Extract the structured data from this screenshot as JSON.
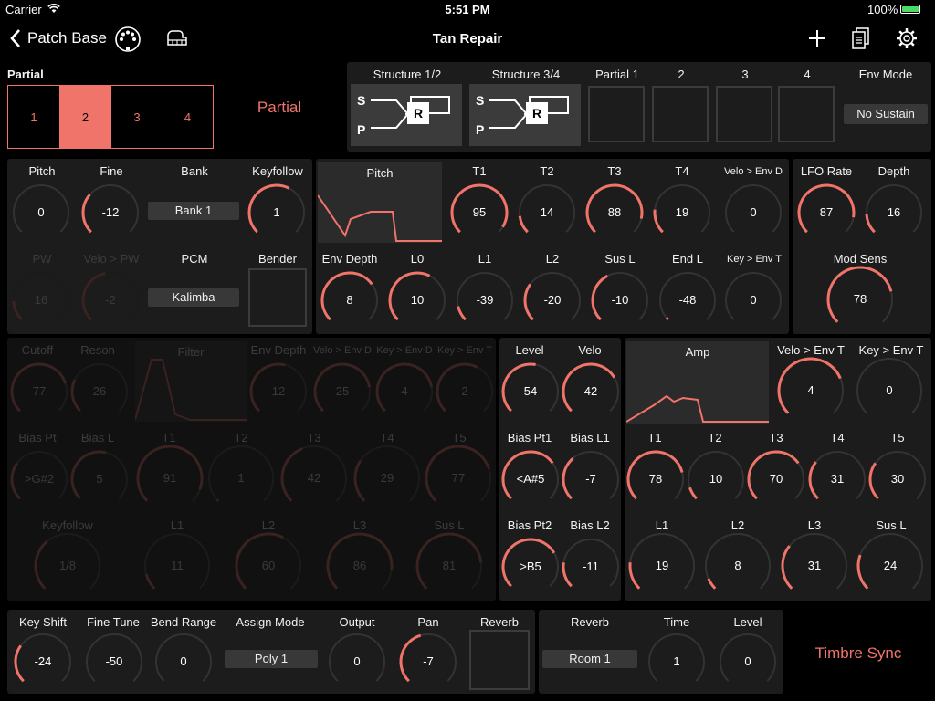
{
  "status": {
    "carrier": "Carrier",
    "time": "5:51 PM",
    "battery": "100%"
  },
  "nav": {
    "back": "Patch Base",
    "title": "Tan Repair",
    "icons": [
      "chevron-left-icon",
      "midi-icon",
      "piano-icon",
      "plus-icon",
      "documents-icon",
      "gear-icon"
    ]
  },
  "accent": "#f0746a",
  "partial_selector": {
    "label": "Partial",
    "items": [
      "1",
      "2",
      "3",
      "4"
    ],
    "selected": "2",
    "side_label": "Partial"
  },
  "structure": {
    "s12": "Structure 1/2",
    "s34": "Structure 3/4",
    "p1": "Partial 1",
    "p2": "2",
    "p3": "3",
    "p4": "4",
    "env_mode": "Env Mode",
    "env_mode_value": "No Sustain",
    "s": "S",
    "p": "P",
    "r": "R"
  },
  "wg": {
    "pitch": {
      "label": "Pitch",
      "value": "0"
    },
    "fine": {
      "label": "Fine",
      "value": "-12"
    },
    "bank": {
      "label": "Bank",
      "value": "Bank 1"
    },
    "keyfollow": {
      "label": "Keyfollow",
      "value": "1"
    },
    "pw": {
      "label": "PW",
      "value": "16"
    },
    "velo_pw": {
      "label": "Velo > PW",
      "value": "-2"
    },
    "pcm": {
      "label": "PCM",
      "value": "Kalimba"
    },
    "bender": {
      "label": "Bender"
    }
  },
  "pitch_env": {
    "title": "Pitch",
    "t1": {
      "label": "T1",
      "value": "95"
    },
    "t2": {
      "label": "T2",
      "value": "14"
    },
    "t3": {
      "label": "T3",
      "value": "88"
    },
    "t4": {
      "label": "T4",
      "value": "19"
    },
    "velo_env": {
      "label": "Velo > Env D",
      "value": "0"
    },
    "env_depth": {
      "label": "Env Depth",
      "value": "8"
    },
    "l0": {
      "label": "L0",
      "value": "10"
    },
    "l1": {
      "label": "L1",
      "value": "-39"
    },
    "l2": {
      "label": "L2",
      "value": "-20"
    },
    "susl": {
      "label": "Sus L",
      "value": "-10"
    },
    "endl": {
      "label": "End L",
      "value": "-48"
    },
    "key_env": {
      "label": "Key > Env T",
      "value": "0"
    }
  },
  "lfo": {
    "rate": {
      "label": "LFO Rate",
      "value": "87"
    },
    "depth": {
      "label": "Depth",
      "value": "16"
    },
    "mod": {
      "label": "Mod Sens",
      "value": "78"
    }
  },
  "filter": {
    "cutoff": {
      "label": "Cutoff",
      "value": "77"
    },
    "reson": {
      "label": "Reson",
      "value": "26"
    },
    "title": "Filter",
    "env_depth": {
      "label": "Env Depth",
      "value": "12"
    },
    "velo_env": {
      "label": "Velo > Env D",
      "value": "25"
    },
    "key_env_d": {
      "label": "Key > Env D",
      "value": "4"
    },
    "key_env_t": {
      "label": "Key > Env T",
      "value": "2"
    },
    "bias_pt": {
      "label": "Bias Pt",
      "value": ">G#2"
    },
    "bias_l": {
      "label": "Bias L",
      "value": "5"
    },
    "t1": {
      "label": "T1",
      "value": "91"
    },
    "t2": {
      "label": "T2",
      "value": "1"
    },
    "t3": {
      "label": "T3",
      "value": "42"
    },
    "t4": {
      "label": "T4",
      "value": "29"
    },
    "t5": {
      "label": "T5",
      "value": "77"
    },
    "keyfollow": {
      "label": "Keyfollow",
      "value": "1/8"
    },
    "l1": {
      "label": "L1",
      "value": "11"
    },
    "l2": {
      "label": "L2",
      "value": "60"
    },
    "l3": {
      "label": "L3",
      "value": "86"
    },
    "susl": {
      "label": "Sus L",
      "value": "81"
    }
  },
  "amp_left": {
    "level": {
      "label": "Level",
      "value": "54"
    },
    "velo": {
      "label": "Velo",
      "value": "42"
    },
    "bias_pt1": {
      "label": "Bias Pt1",
      "value": "<A#5"
    },
    "bias_l1": {
      "label": "Bias L1",
      "value": "-7"
    },
    "bias_pt2": {
      "label": "Bias Pt2",
      "value": ">B5"
    },
    "bias_l2": {
      "label": "Bias L2",
      "value": "-11"
    }
  },
  "amp": {
    "title": "Amp",
    "velo_env": {
      "label": "Velo > Env T",
      "value": "4"
    },
    "key_env": {
      "label": "Key > Env T",
      "value": "0"
    },
    "t1": {
      "label": "T1",
      "value": "78"
    },
    "t2": {
      "label": "T2",
      "value": "10"
    },
    "t3": {
      "label": "T3",
      "value": "70"
    },
    "t4": {
      "label": "T4",
      "value": "31"
    },
    "t5": {
      "label": "T5",
      "value": "30"
    },
    "l1": {
      "label": "L1",
      "value": "19"
    },
    "l2": {
      "label": "L2",
      "value": "8"
    },
    "l3": {
      "label": "L3",
      "value": "31"
    },
    "susl": {
      "label": "Sus L",
      "value": "24"
    }
  },
  "common": {
    "key_shift": {
      "label": "Key Shift",
      "value": "-24"
    },
    "fine_tune": {
      "label": "Fine Tune",
      "value": "-50"
    },
    "bend_range": {
      "label": "Bend Range",
      "value": "0"
    },
    "assign_mode": {
      "label": "Assign Mode",
      "value": "Poly 1"
    },
    "output": {
      "label": "Output",
      "value": "0"
    },
    "pan": {
      "label": "Pan",
      "value": "-7"
    },
    "reverb_sw": {
      "label": "Reverb"
    }
  },
  "reverb": {
    "type": {
      "label": "Reverb",
      "value": "Room 1"
    },
    "time": {
      "label": "Time",
      "value": "1"
    },
    "level": {
      "label": "Level",
      "value": "0"
    }
  },
  "timbre_sync": "Timbre Sync"
}
